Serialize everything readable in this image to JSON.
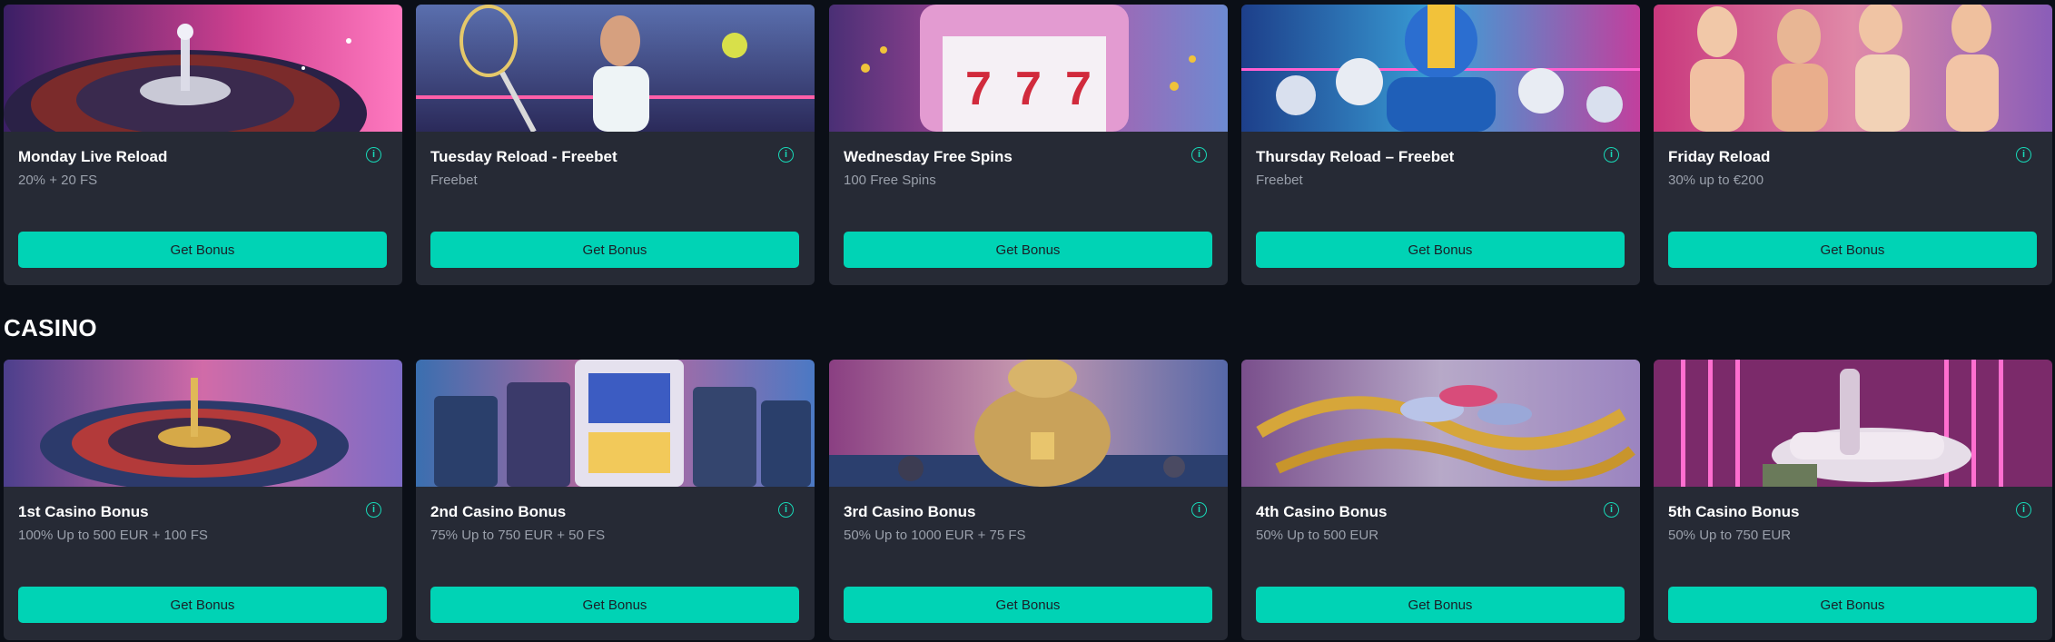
{
  "weekly": [
    {
      "title": "Monday Live Reload",
      "subtitle": "20% + 20 FS",
      "button": "Get Bonus",
      "image": "roulette-wheel-pink-image"
    },
    {
      "title": "Tuesday Reload - Freebet",
      "subtitle": "Freebet",
      "button": "Get Bonus",
      "image": "tennis-player-image"
    },
    {
      "title": "Wednesday Free Spins",
      "subtitle": "100 Free Spins",
      "button": "Get Bonus",
      "image": "slot-machine-777-image"
    },
    {
      "title": "Thursday Reload – Freebet",
      "subtitle": "Freebet",
      "button": "Get Bonus",
      "image": "american-football-image"
    },
    {
      "title": "Friday Reload",
      "subtitle": "30% up to €200",
      "button": "Get Bonus",
      "image": "party-women-image"
    }
  ],
  "casino_section": {
    "title": "CASINO",
    "cards": [
      {
        "title": "1st Casino Bonus",
        "subtitle": "100% Up to 500 EUR + 100 FS",
        "button": "Get Bonus",
        "image": "roulette-table-image"
      },
      {
        "title": "2nd Casino Bonus",
        "subtitle": "75% Up to 750 EUR + 50 FS",
        "button": "Get Bonus",
        "image": "slot-machines-hall-image"
      },
      {
        "title": "3rd Casino Bonus",
        "subtitle": "50% Up to 1000 EUR + 75 FS",
        "button": "Get Bonus",
        "image": "gold-money-bag-image"
      },
      {
        "title": "4th Casino Bonus",
        "subtitle": "50% Up to 500 EUR",
        "button": "Get Bonus",
        "image": "gold-chain-chips-image"
      },
      {
        "title": "5th Casino Bonus",
        "subtitle": "50% Up to 750 EUR",
        "button": "Get Bonus",
        "image": "sports-car-neon-image"
      }
    ]
  },
  "icons": {
    "info": "info-icon",
    "info_glyph": "i"
  },
  "colors": {
    "background": "#0b0f17",
    "card": "#262a35",
    "accent": "#00d3b5",
    "subtitle": "#9aa0ab"
  }
}
